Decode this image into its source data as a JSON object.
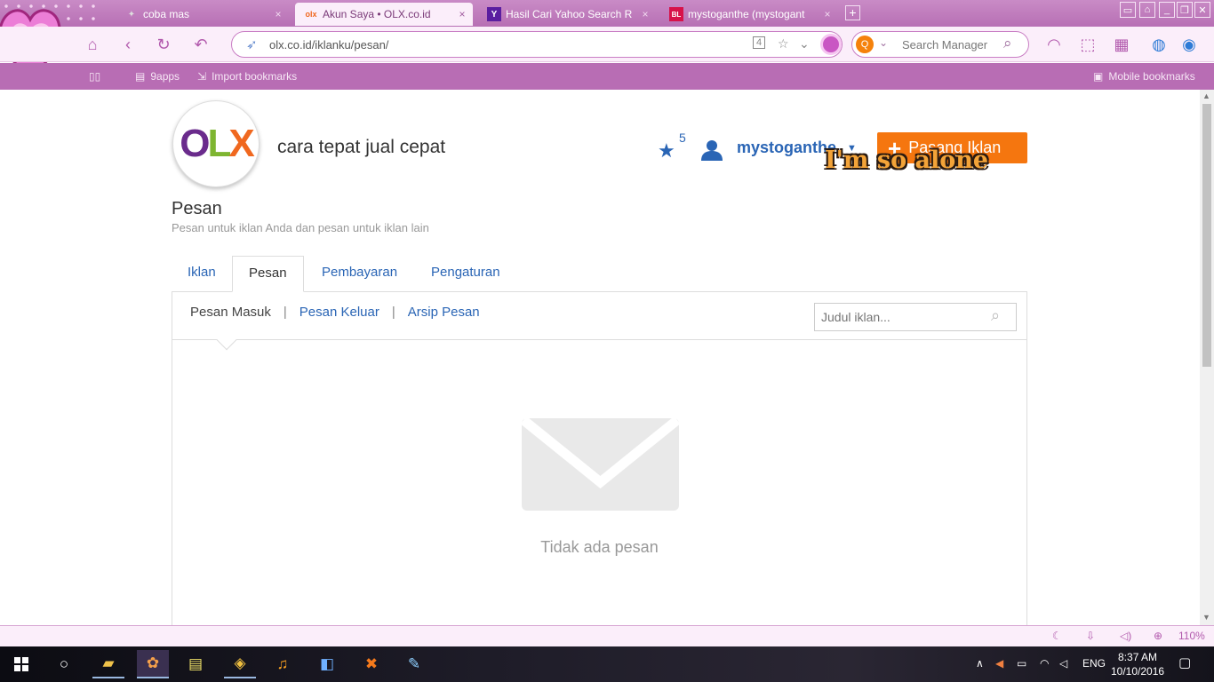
{
  "browser": {
    "tabs": [
      {
        "label": "coba mas",
        "close": "×",
        "active": false
      },
      {
        "label": "Akun Saya • OLX.co.id",
        "icon_text": "olx",
        "close": "×",
        "active": true
      },
      {
        "label": "Hasil Cari Yahoo Search R",
        "icon_text": "Y",
        "close": "×",
        "active": false
      },
      {
        "label": "mystoganthe (mystogant",
        "icon_text": "BL",
        "close": "×",
        "active": false
      }
    ],
    "new_tab": "+",
    "url": "olx.co.id/iklanku/pesan/",
    "tab_count": "4",
    "search_placeholder": "Search Manager",
    "bookmarks": {
      "bar1": "9apps",
      "bar2": "Import bookmarks",
      "mobile": "Mobile bookmarks"
    },
    "status": {
      "zoom": "110%"
    }
  },
  "header": {
    "logo_o": "O",
    "logo_l": "L",
    "logo_x": "X",
    "tagline": "cara tepat jual cepat",
    "favorites_count": "5",
    "username": "mystoganthe",
    "post_button": "Pasang Iklan",
    "overlay_text": "I'm so alone"
  },
  "page": {
    "title": "Pesan",
    "subtitle": "Pesan untuk iklan Anda dan pesan untuk iklan lain",
    "tabs": [
      "Iklan",
      "Pesan",
      "Pembayaran",
      "Pengaturan"
    ],
    "subnav": {
      "inbox": "Pesan Masuk",
      "outbox": "Pesan Keluar",
      "archive": "Arsip Pesan",
      "sep": "|"
    },
    "filter_placeholder": "Judul iklan...",
    "empty_text": "Tidak ada pesan"
  },
  "taskbar": {
    "lang": "ENG",
    "time": "8:37 AM",
    "date": "10/10/2016"
  },
  "colors": {
    "accent_purple": "#b86db4",
    "olx_blue": "#2a65b5",
    "olx_orange": "#f5760f"
  }
}
